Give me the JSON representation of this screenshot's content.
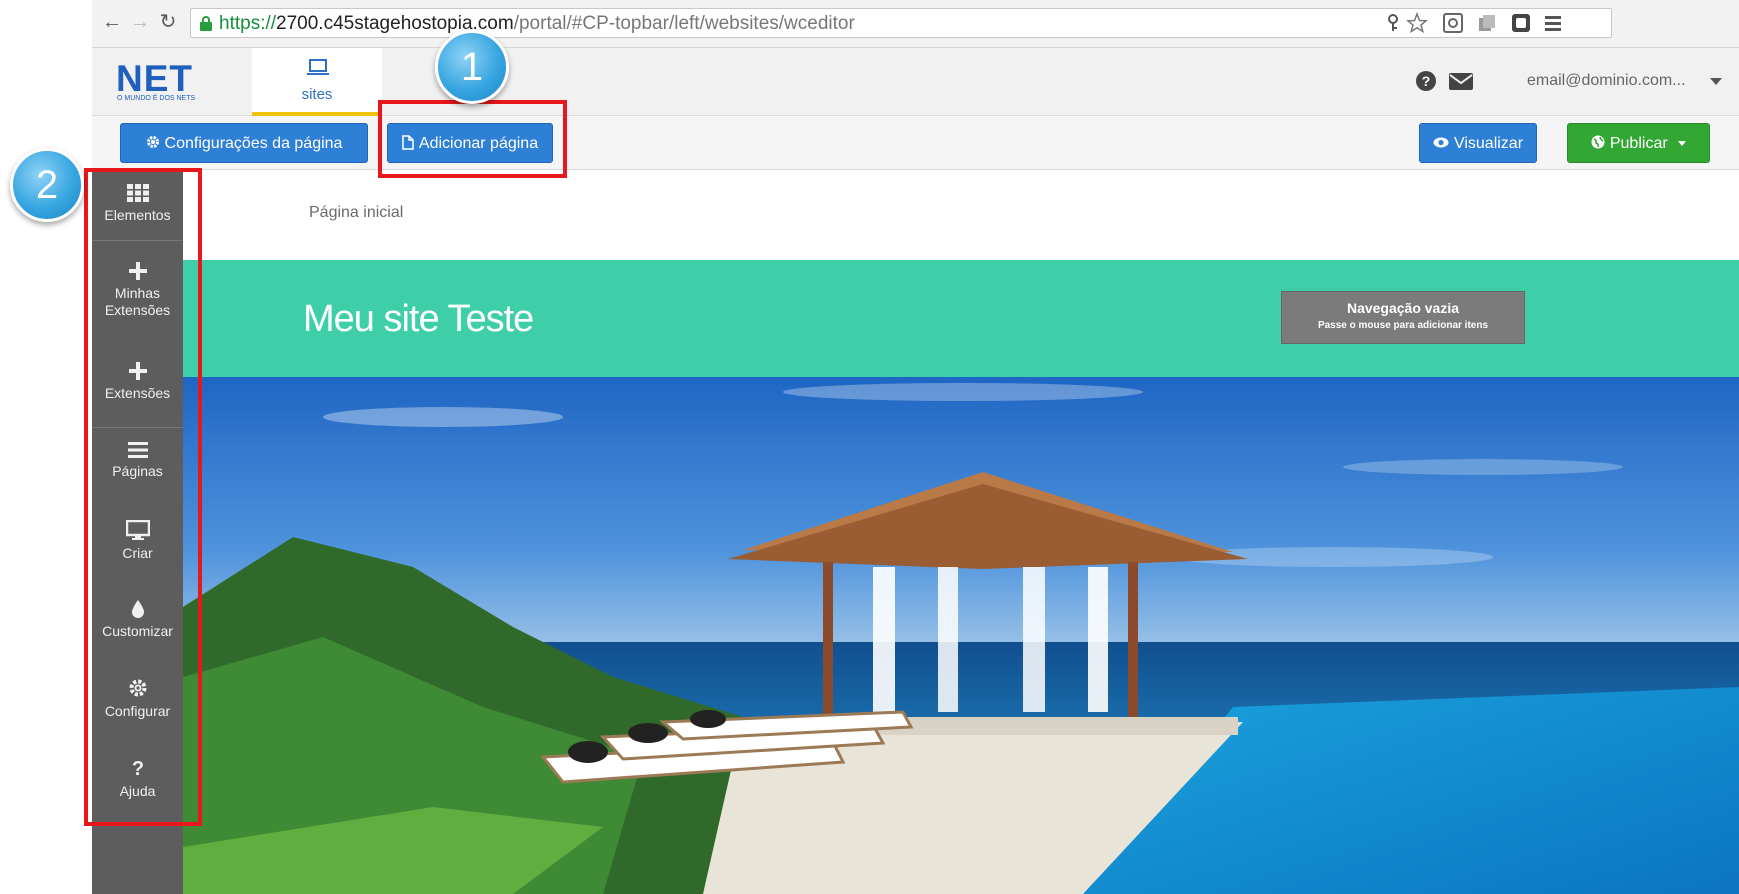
{
  "browser": {
    "url_scheme": "https://",
    "url_host": "2700.c45stagehostopia.com",
    "url_path": "/portal/#CP-topbar/left/websites/wceditor"
  },
  "topbar": {
    "logo_text": "NET",
    "logo_tagline": "O MUNDO É DOS NETS",
    "tab_label": "sites",
    "user_email": "email@dominio.com..."
  },
  "toolbar": {
    "page_settings_label": "Configurações da página",
    "add_page_label": "Adicionar página",
    "preview_label": "Visualizar",
    "publish_label": "Publicar"
  },
  "sidebar": {
    "items": [
      {
        "label": "Elementos",
        "icon": "grid-icon"
      },
      {
        "label": "Minhas Extensões",
        "icon": "plus-icon"
      },
      {
        "label": "Extensões",
        "icon": "plus-icon"
      },
      {
        "label": "Páginas",
        "icon": "menu-lines-icon"
      },
      {
        "label": "Criar",
        "icon": "monitor-icon"
      },
      {
        "label": "Customizar",
        "icon": "drop-icon"
      },
      {
        "label": "Configurar",
        "icon": "gear-icon"
      },
      {
        "label": "Ajuda",
        "icon": "question-icon"
      }
    ]
  },
  "canvas": {
    "breadcrumb": "Página inicial",
    "site_title": "Meu site Teste",
    "empty_nav_title": "Navegação vazia",
    "empty_nav_hint": "Passe o mouse para adicionar itens"
  },
  "callouts": {
    "one": "1",
    "two": "2"
  },
  "colors": {
    "brand_blue": "#1f5fbd",
    "header_teal": "#3ecfa9",
    "button_blue": "#2e7fd6",
    "button_green": "#33a733",
    "callout_red": "#e8171c",
    "sidebar_gray": "#5d5d5d"
  }
}
